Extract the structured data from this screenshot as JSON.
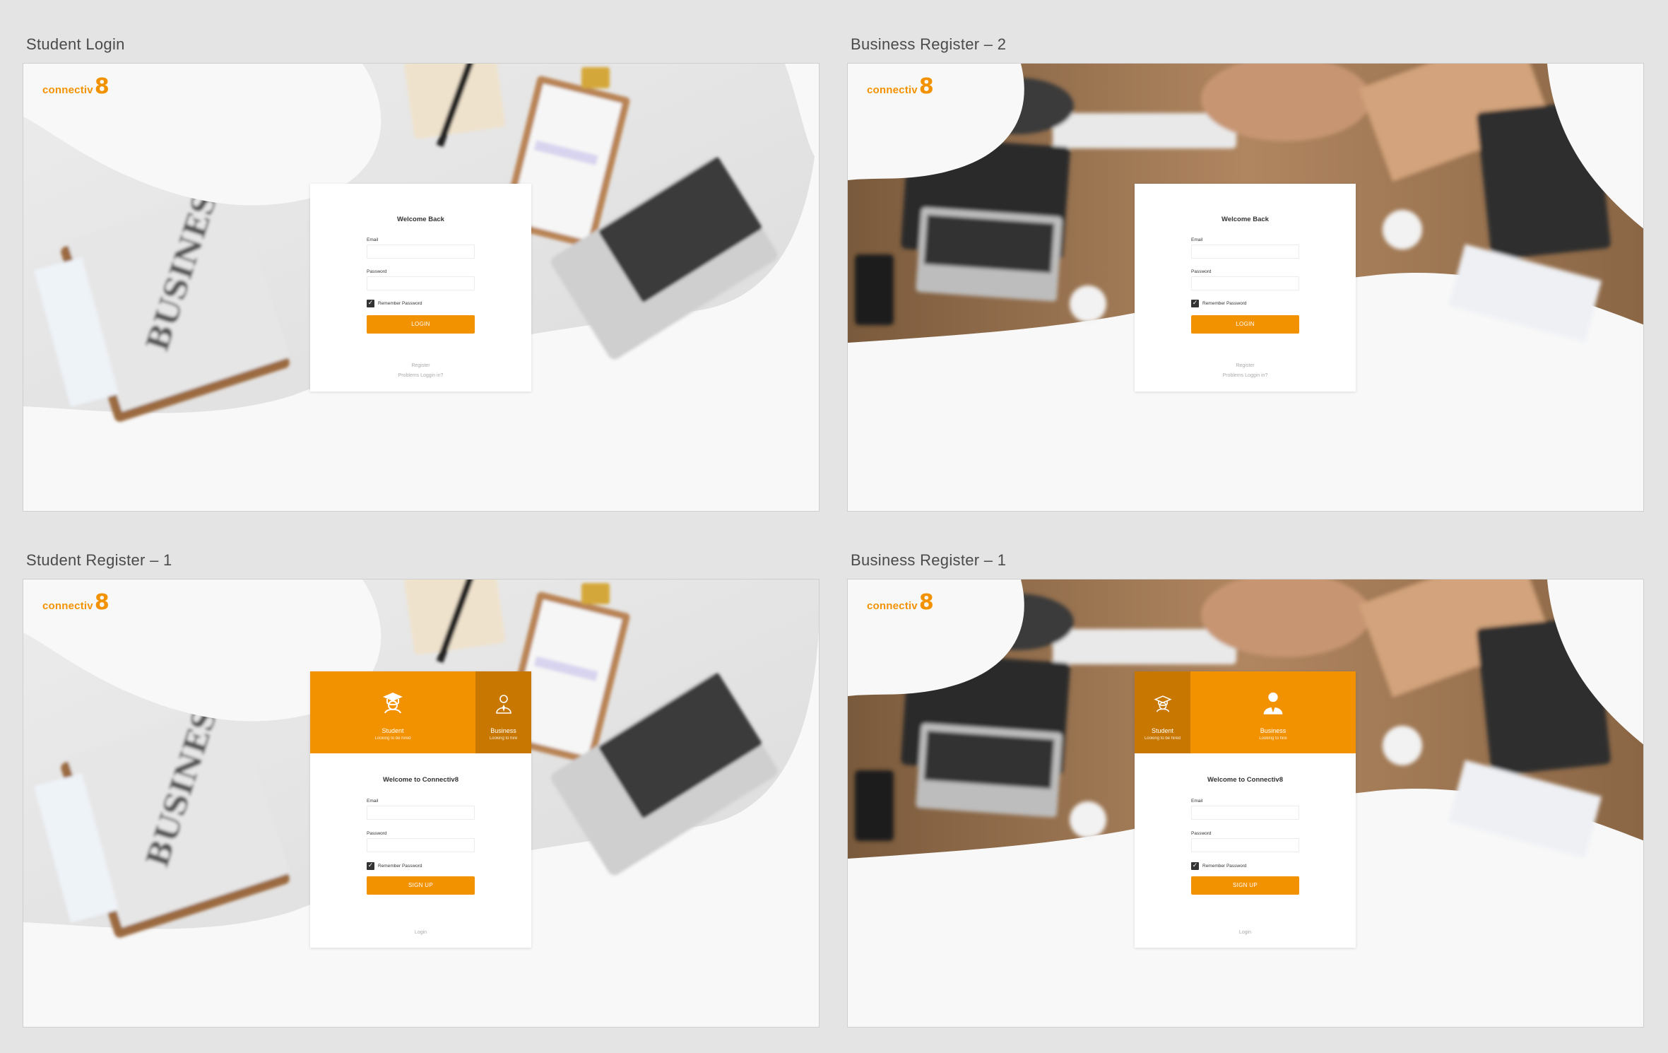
{
  "artboards": {
    "student_login": {
      "title": "Student Login"
    },
    "business_register_2": {
      "title": "Business Register – 2"
    },
    "student_register_1": {
      "title": "Student Register – 1"
    },
    "business_register_1": {
      "title": "Business Register – 1"
    }
  },
  "brand": {
    "logo_text": "connectiv",
    "logo_mark": "8",
    "accent_color": "#f39200",
    "accent_dark_color": "#c87800"
  },
  "login_form": {
    "title": "Welcome Back",
    "email_label": "Email",
    "password_label": "Password",
    "remember_label": "Remember Password",
    "remember_checked": true,
    "submit_label": "LOGIN",
    "register_link": "Register",
    "problems_link": "Problems Loggin in?"
  },
  "register_form": {
    "title": "Welcome to Connectiv8",
    "email_label": "Email",
    "password_label": "Password",
    "remember_label": "Remember Password",
    "remember_checked": true,
    "submit_label": "SIGN UP",
    "login_link": "Login",
    "student_tab": {
      "name": "Student",
      "subtitle": "Looking to be hired"
    },
    "business_tab": {
      "name": "Business",
      "subtitle": "Looking to hire"
    }
  }
}
